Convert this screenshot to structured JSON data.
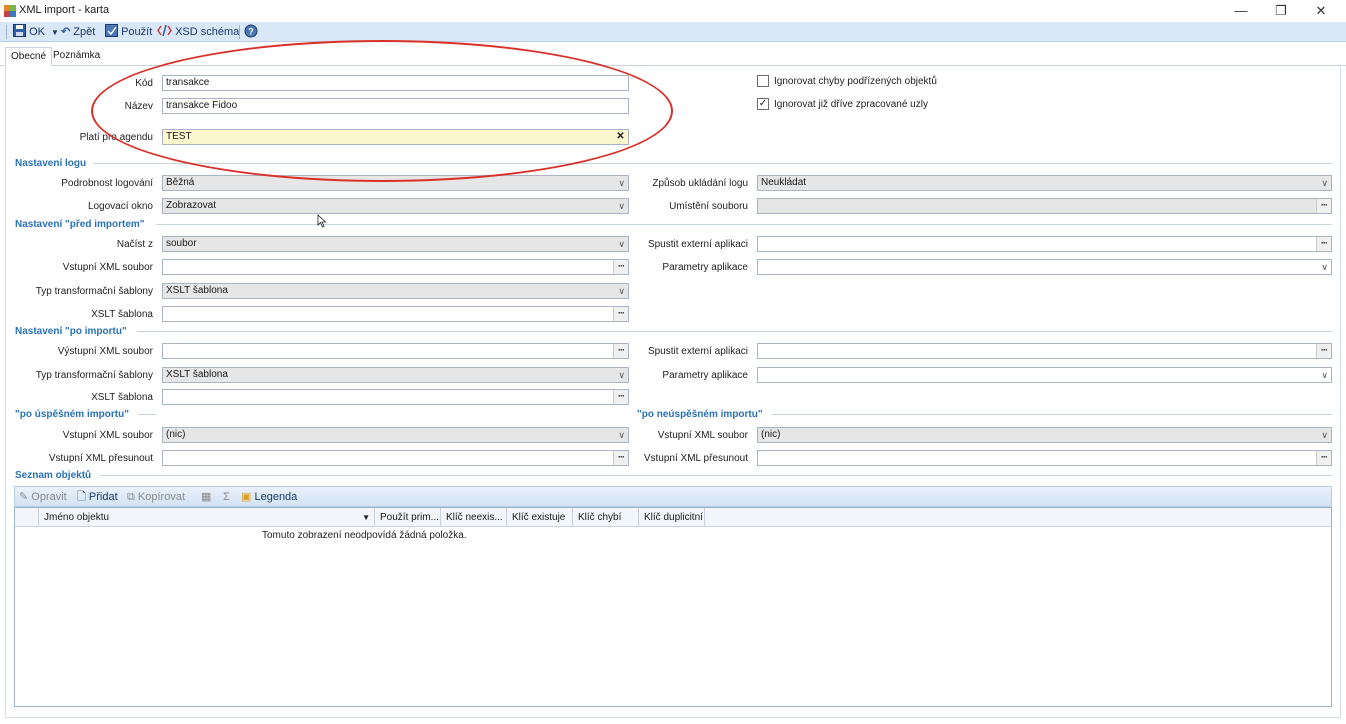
{
  "window": {
    "title": "XML import - karta",
    "minimize": "—",
    "restore": "❐",
    "close": "✕"
  },
  "toolbar": {
    "ok": "OK",
    "back": "Zpět",
    "apply": "Použít",
    "xsd": "XSD schéma"
  },
  "tabs": [
    "Obecné",
    "Poznámka"
  ],
  "general": {
    "kod_label": "Kód",
    "kod_value": "transakce",
    "nazev_label": "Název",
    "nazev_value": "transakce Fidoo",
    "agenda_label": "Platí pro agendu",
    "agenda_value": "TEST",
    "ignore_errors": "Ignorovat chyby podřízených objektů",
    "ignore_errors_checked": false,
    "ignore_processed": "Ignorovat již dříve zpracované uzly",
    "ignore_processed_checked": true
  },
  "log": {
    "section": "Nastavení logu",
    "detail_label": "Podrobnost logování",
    "detail_value": "Běžná",
    "window_label": "Logovací okno",
    "window_value": "Zobrazovat",
    "save_mode_label": "Způsob ukládání logu",
    "save_mode_value": "Neukládat",
    "file_location_label": "Umístění souboru",
    "file_location_value": ""
  },
  "before_import": {
    "section": "Nastavení \"před importem\"",
    "load_from_label": "Načíst z",
    "load_from_value": "soubor",
    "input_xml_label": "Vstupní XML soubor",
    "input_xml_value": "",
    "template_type_label": "Typ transformační šablony",
    "template_type_value": "XSLT šablona",
    "xslt_label": "XSLT šablona",
    "xslt_value": "",
    "run_app_label": "Spustit externí aplikaci",
    "run_app_value": "",
    "app_params_label": "Parametry aplikace",
    "app_params_value": ""
  },
  "after_import": {
    "section": "Nastavení \"po importu\"",
    "output_xml_label": "Výstupní XML soubor",
    "output_xml_value": "",
    "template_type_label": "Typ transformační šablony",
    "template_type_value": "XSLT šablona",
    "xslt_label": "XSLT šablona",
    "xslt_value": "",
    "run_app_label": "Spustit externí aplikaci",
    "run_app_value": "",
    "app_params_label": "Parametry aplikace",
    "app_params_value": ""
  },
  "success": {
    "section": "\"po úspěšném importu\"",
    "input_xml_label": "Vstupní XML soubor",
    "input_xml_value": "(nic)",
    "move_label": "Vstupní XML přesunout",
    "move_value": ""
  },
  "failure": {
    "section": "\"po neúspěšném importu\"",
    "input_xml_label": "Vstupní XML soubor",
    "input_xml_value": "(nic)",
    "move_label": "Vstupní XML přesunout",
    "move_value": ""
  },
  "objects": {
    "section": "Seznam objektů",
    "toolbar": {
      "edit": "Opravit",
      "add": "Přidat",
      "copy": "Kopírovat",
      "sum": "Σ",
      "legend": "Legenda"
    },
    "columns": [
      "Jméno objektu",
      "Použít prim...",
      "Klíč neexis...",
      "Klíč existuje",
      "Klíč chybí",
      "Klíč duplicitní"
    ],
    "empty_message": "Tomuto zobrazení neodpovídá žádná položka."
  },
  "icons": {
    "app": "app-icon",
    "ok": "save-icon",
    "back": "undo-icon",
    "apply": "apply-icon",
    "xsd": "xsd-icon",
    "help": "help-icon"
  },
  "colors": {
    "section_title": "#2a71b8",
    "toolbar_bg": "#d9e7f7",
    "highlight_field": "#fdf7cf",
    "annotation_ellipse": "#d9302a"
  }
}
